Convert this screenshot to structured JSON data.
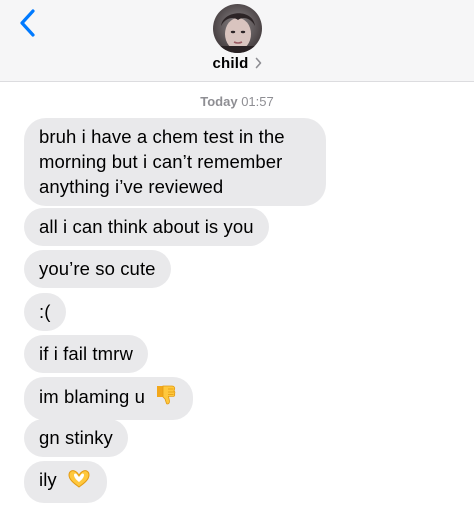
{
  "header": {
    "contact_name": "child",
    "back_icon": "chevron-left-icon",
    "name_chevron": "chevron-right-icon"
  },
  "timestamp": {
    "day": "Today",
    "time": "01:57"
  },
  "messages": [
    {
      "text": "bruh i have a chem test in the morning but i can’t remember anything i’ve reviewed"
    },
    {
      "text": "all i can think about is you"
    },
    {
      "text": "you’re so cute"
    },
    {
      "text": ":("
    },
    {
      "text": "if i fail tmrw"
    },
    {
      "text": "im blaming u",
      "emoji": "thumbs-down-emoji"
    },
    {
      "text": "gn stinky"
    },
    {
      "text": "ily",
      "emoji": "heart-hands-emoji"
    }
  ],
  "colors": {
    "accent": "#007aff",
    "bubble": "#e9e9eb",
    "header_bg": "#f6f6f7",
    "timestamp": "#8e8e93"
  }
}
